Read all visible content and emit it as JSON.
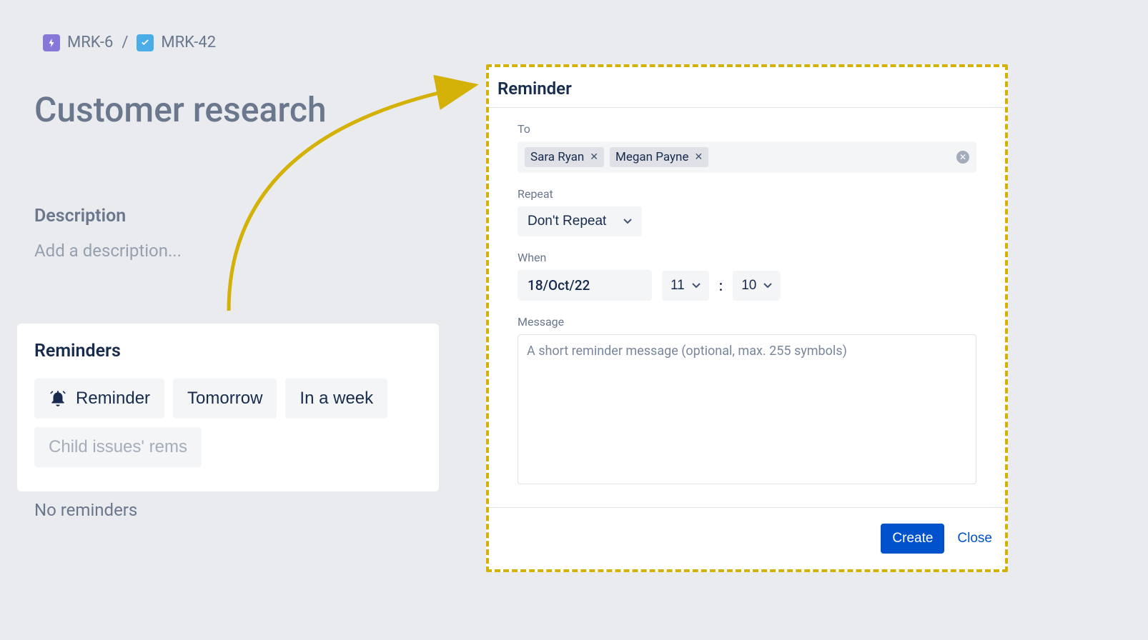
{
  "breadcrumb": {
    "parent": "MRK-6",
    "current": "MRK-42",
    "separator": "/"
  },
  "page_title": "Customer research",
  "description": {
    "label": "Description",
    "placeholder": "Add a description..."
  },
  "reminders": {
    "title": "Reminders",
    "buttons": {
      "reminder": "Reminder",
      "tomorrow": "Tomorrow",
      "in_a_week": "In a week",
      "child_issues": "Child issues' rems"
    },
    "empty_state": "No reminders"
  },
  "dialog": {
    "title": "Reminder",
    "to_label": "To",
    "recipients": [
      "Sara Ryan",
      "Megan Payne"
    ],
    "repeat_label": "Repeat",
    "repeat_value": "Don't Repeat",
    "when_label": "When",
    "date_value": "18/Oct/22",
    "hour_value": "11",
    "minute_value": "10",
    "message_label": "Message",
    "message_placeholder": "A short reminder message (optional, max. 255 symbols)",
    "create_label": "Create",
    "close_label": "Close"
  }
}
